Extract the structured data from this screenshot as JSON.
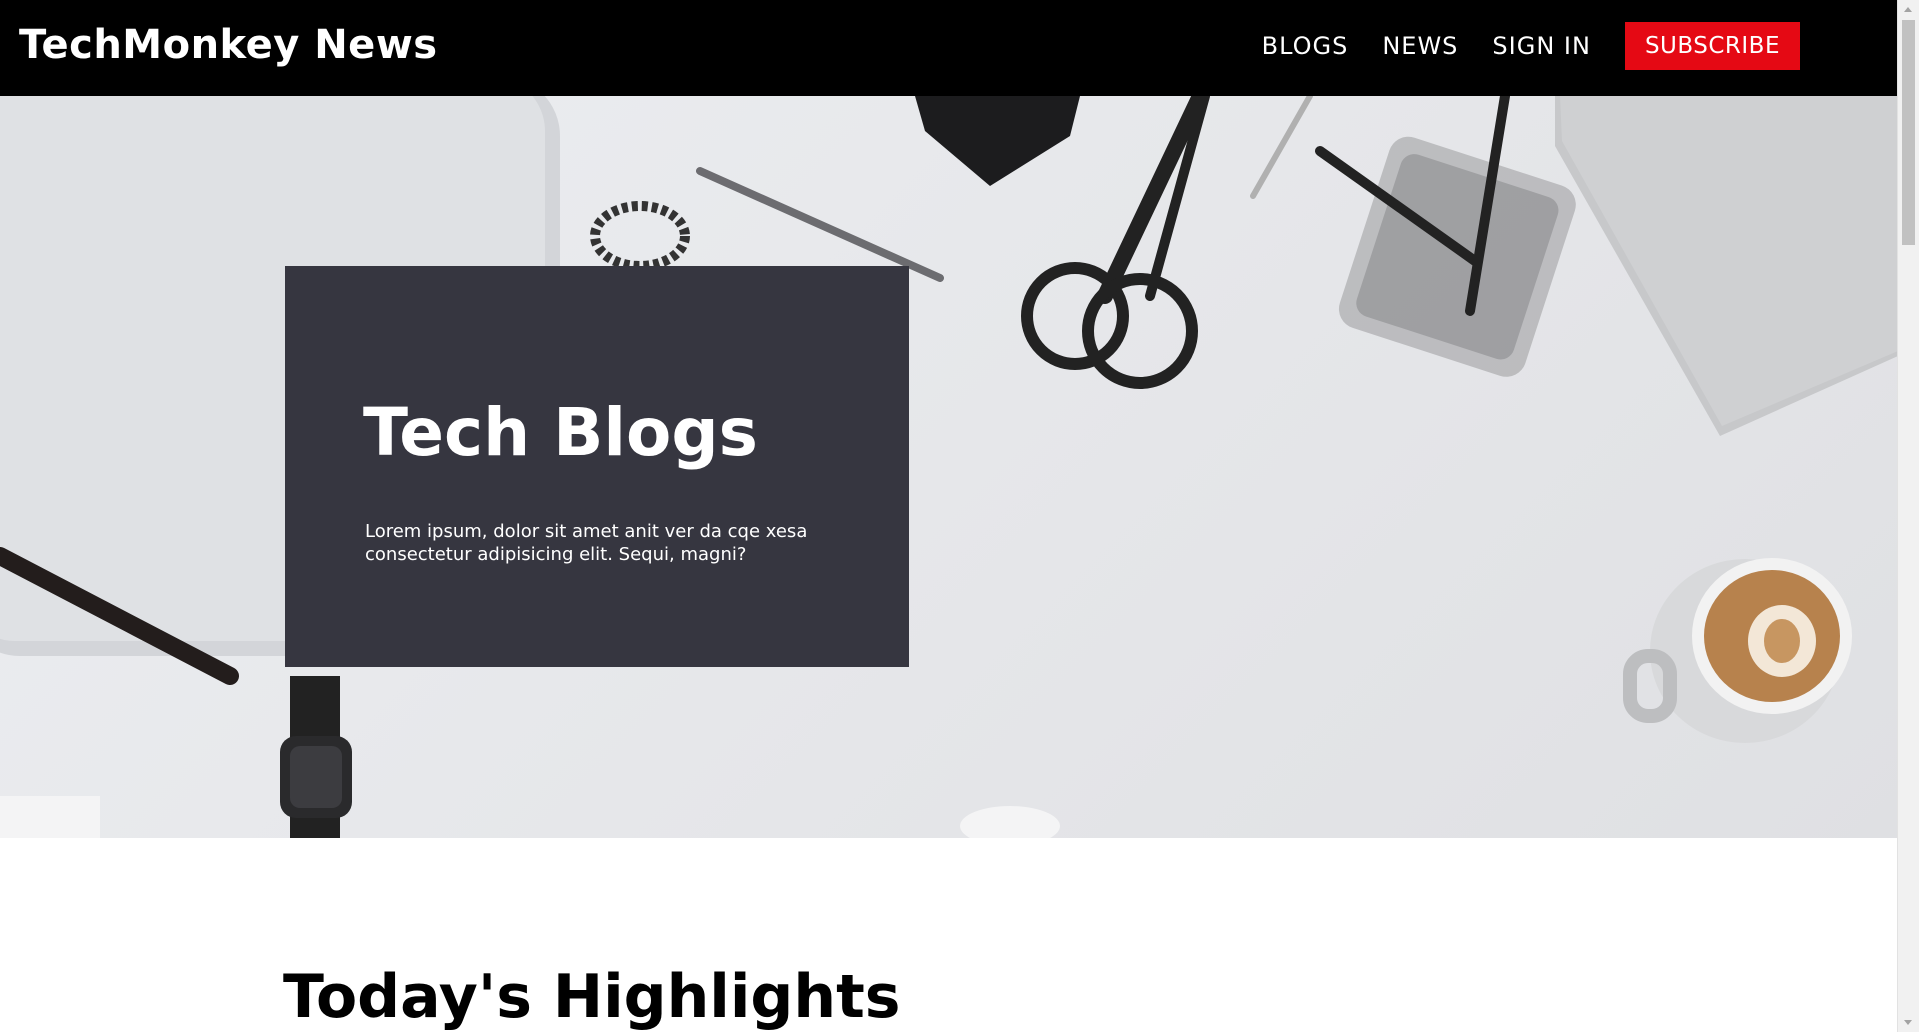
{
  "navbar": {
    "brand": "TechMonkey News",
    "links": [
      "BLOGS",
      "NEWS",
      "SIGN IN"
    ],
    "subscribe_label": "SUBSCRIBE"
  },
  "hero": {
    "title": "Tech Blogs",
    "text": "Lorem ipsum, dolor sit amet anit ver da cqe xesa consectetur adipisicing elit. Sequi, magni?"
  },
  "highlights": {
    "title": "Today's Highlights"
  },
  "colors": {
    "navbar_bg": "#000000",
    "subscribe_bg": "#e50914",
    "card_bg": "#363640"
  }
}
